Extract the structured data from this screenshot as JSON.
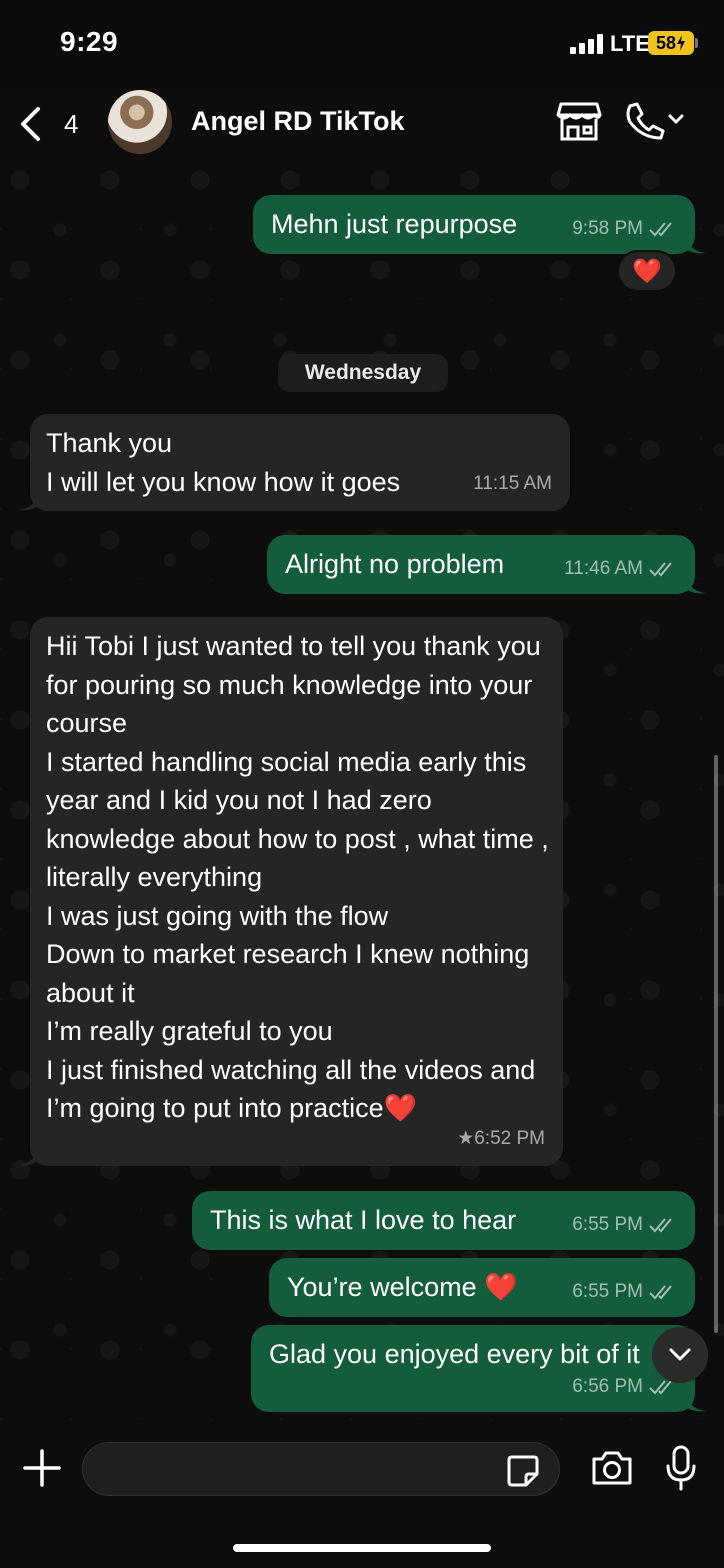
{
  "status_bar": {
    "time": "9:29",
    "network": "LTE",
    "battery": "58"
  },
  "header": {
    "back_count": "4",
    "contact_name": "Angel RD TikTok"
  },
  "messages": [
    {
      "direction": "out",
      "text": "Mehn just repurpose",
      "time": "9:58 PM",
      "reaction": "❤️"
    },
    {
      "direction": "in",
      "text": "Thank you\nI will let you know how it goes",
      "time": "11:15 AM"
    },
    {
      "direction": "out",
      "text": "Alright no problem",
      "time": "11:46 AM"
    },
    {
      "direction": "in",
      "text": "Hii Tobi I just wanted to tell you thank you for pouring so much knowledge into your course\nI started handling social media early this year and I kid you not I had zero knowledge about how to post , what time , literally everything\nI was just going with the flow\nDown to market research I knew nothing about it\nI’m really grateful to you\nI just finished watching all the videos and I’m going to put into practice❤️",
      "time": "★6:52 PM",
      "starred": true
    },
    {
      "direction": "out",
      "text": "This is what I love to hear",
      "time": "6:55 PM"
    },
    {
      "direction": "out",
      "text": "You’re welcome ❤️",
      "time": "6:55 PM"
    },
    {
      "direction": "out",
      "text": "Glad you enjoyed every bit of it",
      "time": "6:56 PM"
    }
  ],
  "date_divider": "Wednesday",
  "composer": {
    "input_value": ""
  },
  "colors": {
    "outgoing_bubble": "#135c3c",
    "incoming_bubble": "#242626",
    "background": "#0b0b0b",
    "battery": "#f2c318"
  },
  "icons": [
    "back-chevron-icon",
    "store-icon",
    "phone-icon",
    "chevron-down-icon",
    "plus-icon",
    "sticker-icon",
    "camera-icon",
    "mic-icon",
    "double-check-icon",
    "heart-reaction-icon"
  ]
}
